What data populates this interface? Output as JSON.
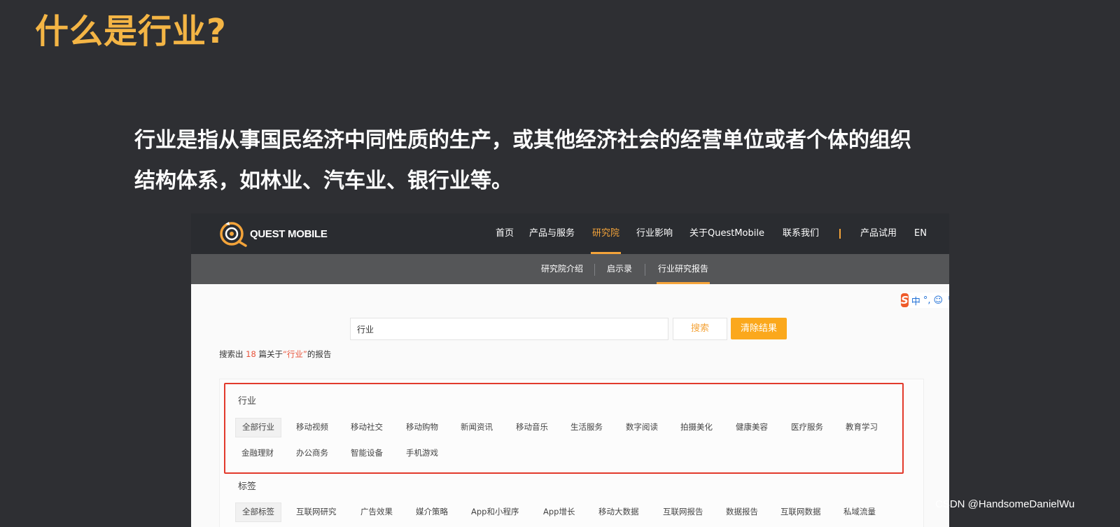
{
  "slide": {
    "title": "什么是行业?",
    "body_line1": "行业是指从事国民经济中同性质的生产，或其他经济社会的经营单位或者个体的组织",
    "body_line2": "结构体系，如林业、汽车业、银行业等。"
  },
  "screenshot": {
    "logo_text": "QUEST MOBILE",
    "nav": {
      "items": [
        "首页",
        "产品与服务",
        "研究院",
        "行业影响",
        "关于QuestMobile",
        "联系我们",
        "产品试用",
        "EN"
      ],
      "active": "研究院"
    },
    "subnav": {
      "items": [
        "研究院介绍",
        "启示录",
        "行业研究报告"
      ],
      "active": "行业研究报告"
    },
    "ime_toolbar": {
      "logo": "S",
      "mode": "中",
      "punct": "°,",
      "emoji": "☺",
      "mic": "🎙"
    },
    "search": {
      "value": "行业",
      "search_label": "搜索",
      "clear_label": "清除结果"
    },
    "result": {
      "prefix": "搜索出",
      "count": "18",
      "middle": "篇关于",
      "keyword": "“行业”",
      "suffix": "的报告"
    },
    "industry_group": {
      "title": "行业",
      "chips": [
        "全部行业",
        "移动视频",
        "移动社交",
        "移动购物",
        "新闻资讯",
        "移动音乐",
        "生活服务",
        "数字阅读",
        "拍摄美化",
        "健康美容",
        "医疗服务",
        "教育学习",
        "金融理财",
        "办公商务",
        "智能设备",
        "手机游戏"
      ]
    },
    "tag_group": {
      "title": "标签",
      "chips": [
        "全部标签",
        "互联网研究",
        "广告效果",
        "媒介策略",
        "App和小程序",
        "App增长",
        "移动大数据",
        "互联网报告",
        "数据报告",
        "互联网数据",
        "私域流量"
      ]
    }
  },
  "watermark": "CSDN @HandsomeDanielWu"
}
